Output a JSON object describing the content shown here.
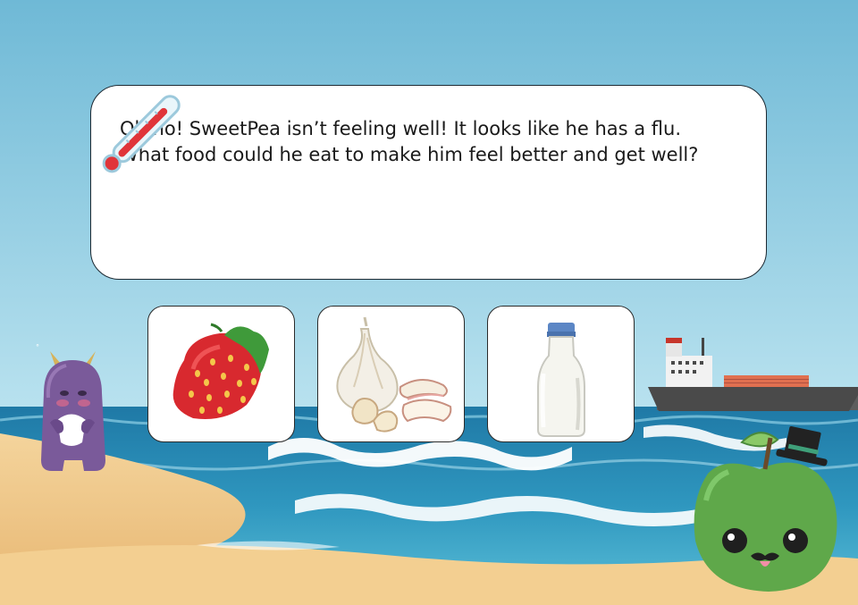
{
  "dialog": {
    "line1": "Oh no! SweetPea isn’t feeling well! It looks like he has a flu.",
    "line2": "What food could he eat to make him feel better and get well?"
  },
  "choices": [
    {
      "id": "strawberry",
      "icon": "strawberry-icon"
    },
    {
      "id": "garlic",
      "icon": "garlic-icon"
    },
    {
      "id": "milk",
      "icon": "milk-bottle-icon"
    }
  ],
  "colors": {
    "sky": "#7cc3dc",
    "sea": "#2f8fb8",
    "sand": "#f1cc8c",
    "monster": "#7a5a9a",
    "apple": "#5fa84a",
    "thermometer_red": "#e0353a"
  }
}
